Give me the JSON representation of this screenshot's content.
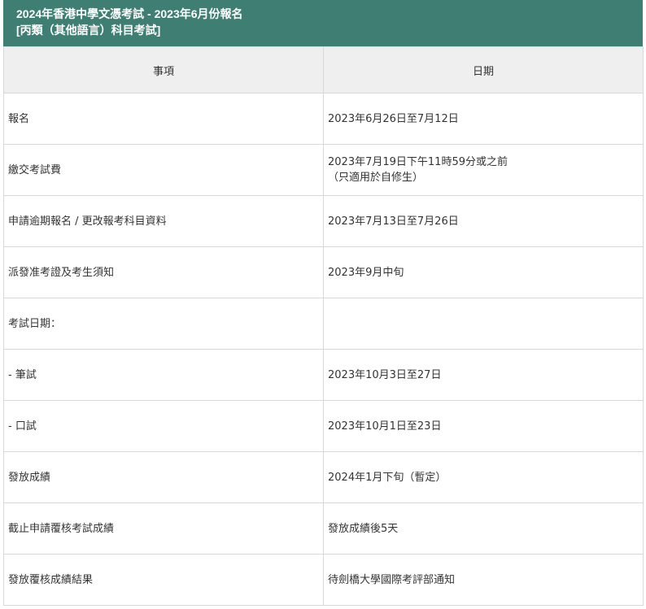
{
  "header": {
    "title_line1": "2024年香港中學文憑考試 - 2023年6月份報名",
    "title_line2": "[丙類（其他語言）科目考試]"
  },
  "table": {
    "columns": [
      "事項",
      "日期"
    ],
    "rows": [
      {
        "item": "報名",
        "date": [
          "2023年6月26日至7月12日"
        ]
      },
      {
        "item": "繳交考試費",
        "date": [
          "2023年7月19日下午11時59分或之前",
          "（只適用於自修生）"
        ]
      },
      {
        "item": "申請逾期報名 / 更改報考科目資料",
        "date": [
          "2023年7月13日至7月26日"
        ]
      },
      {
        "item": "派發准考證及考生須知",
        "date": [
          "2023年9月中旬"
        ]
      },
      {
        "item": "考試日期：",
        "date": [
          ""
        ]
      },
      {
        "item": "- 筆試",
        "date": [
          "2023年10月3日至27日"
        ]
      },
      {
        "item": "- 口試",
        "date": [
          "2023年10月1日至23日"
        ]
      },
      {
        "item": "發放成績",
        "date": [
          "2024年1月下旬（暫定）"
        ]
      },
      {
        "item": "截止申請覆核考試成績",
        "date": [
          "發放成績後5天"
        ]
      },
      {
        "item": "發放覆核成績結果",
        "date": [
          "待劍橋大學國際考評部通知"
        ]
      }
    ]
  },
  "colors": {
    "header_bg": "#3f7f73",
    "header_text": "#ffffff",
    "column_header_bg": "#efefef",
    "border": "#d8d8d8"
  }
}
